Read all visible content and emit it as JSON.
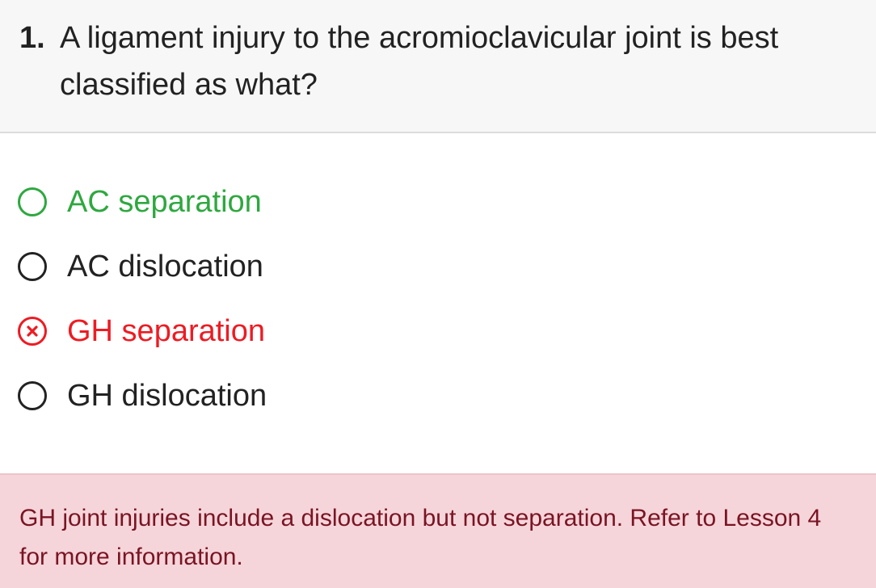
{
  "question": {
    "number": "1.",
    "text": "A ligament injury to the acromioclavicular joint is best classified as what?"
  },
  "options": [
    {
      "label": "AC separation",
      "state": "correct",
      "icon": "radio-circle-icon"
    },
    {
      "label": "AC dislocation",
      "state": "neutral",
      "icon": "radio-circle-icon"
    },
    {
      "label": "GH separation",
      "state": "incorrect",
      "icon": "x-circle-icon"
    },
    {
      "label": "GH dislocation",
      "state": "neutral",
      "icon": "radio-circle-icon"
    }
  ],
  "feedback": {
    "text": "GH joint injuries include a dislocation but not separation. Refer to Lesson 4 for more information."
  },
  "colors": {
    "correct": "#2ea83f",
    "incorrect": "#ee1b22",
    "feedback_background": "#f5d5da",
    "feedback_text": "#7a1423",
    "header_background": "#f7f7f7"
  }
}
